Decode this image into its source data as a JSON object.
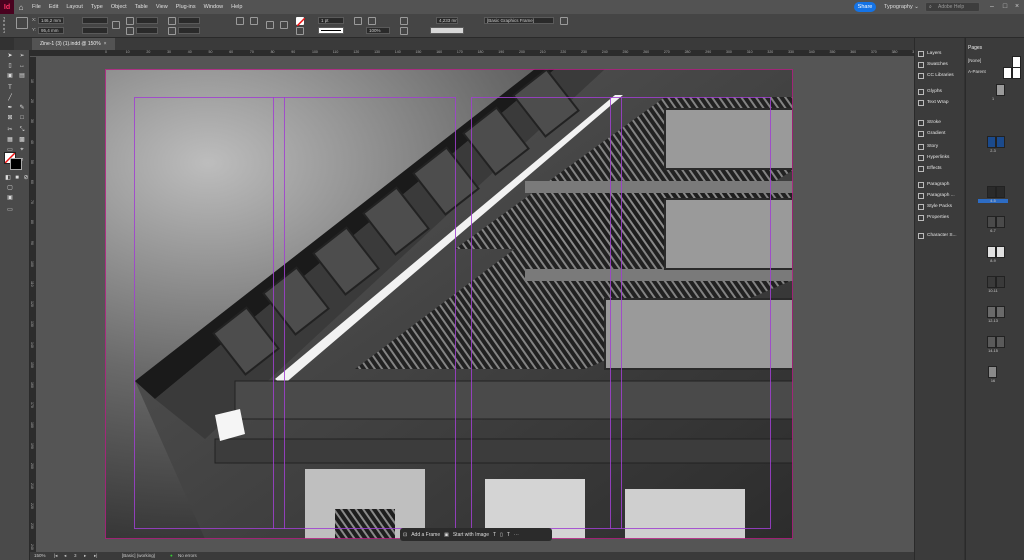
{
  "app": {
    "logo": "Id"
  },
  "menu": [
    "File",
    "Edit",
    "Layout",
    "Type",
    "Object",
    "Table",
    "View",
    "Plug-ins",
    "Window",
    "Help"
  ],
  "menubar_right": {
    "share": "Share",
    "workspace": "Typography",
    "search_placeholder": "Adobe Help"
  },
  "control": {
    "x_field": "146,2 mm",
    "y_field": "95,4 mm",
    "stroke_weight": "1 pt",
    "opacity": "100%",
    "gap_field": "4,233 mm",
    "object_style": "[Basic Graphics Frame]"
  },
  "document_tab": {
    "title": "Zine-1 (3) (1).indd @ 150%",
    "close": "×"
  },
  "rulers": {
    "h": [
      "0",
      "10",
      "20",
      "30",
      "40",
      "50",
      "60",
      "70",
      "80",
      "90",
      "100",
      "110",
      "120",
      "130",
      "140",
      "150",
      "160",
      "170",
      "180",
      "190",
      "200",
      "210",
      "220",
      "230",
      "240",
      "250",
      "260",
      "270",
      "280",
      "290",
      "300",
      "310",
      "320",
      "330",
      "340",
      "350",
      "360",
      "370",
      "380",
      "390",
      "400",
      "410",
      "420"
    ],
    "v": [
      "10",
      "20",
      "30",
      "40",
      "50",
      "60",
      "70",
      "80",
      "90",
      "100",
      "110",
      "120",
      "130",
      "140",
      "150",
      "160",
      "170",
      "180",
      "190",
      "200",
      "210",
      "220",
      "230",
      "240"
    ]
  },
  "context_bar": {
    "add_frame": "Add a Frame",
    "start_image": "Start with Image"
  },
  "status": {
    "zoom": "150%",
    "page": "3",
    "style": "[Basic] (working)",
    "errors": "No errors"
  },
  "panels": {
    "group1": [
      "Layers",
      "Swatches",
      "CC Libraries"
    ],
    "group2": [
      "Glyphs",
      "Text Wrap"
    ],
    "group3": [
      "Stroke",
      "Gradient"
    ],
    "group4": [
      "Story",
      "Hyperlinks",
      "Effects"
    ],
    "group5": [
      "Paragraph",
      "Paragraph ...",
      "Style Packs",
      "Properties"
    ],
    "group6": [
      "Character S..."
    ]
  },
  "pages_panel": {
    "title": "Pages",
    "none": "[None]",
    "parent": "A-Parent",
    "spreads": [
      "1",
      "2-3",
      "4-5",
      "6-7",
      "8-9",
      "10-11",
      "12-13",
      "14-15",
      "16"
    ]
  },
  "colors": {
    "accent": "#1473e6",
    "guide": "#a040d0",
    "selected_thumb": "#2d6cc4"
  }
}
